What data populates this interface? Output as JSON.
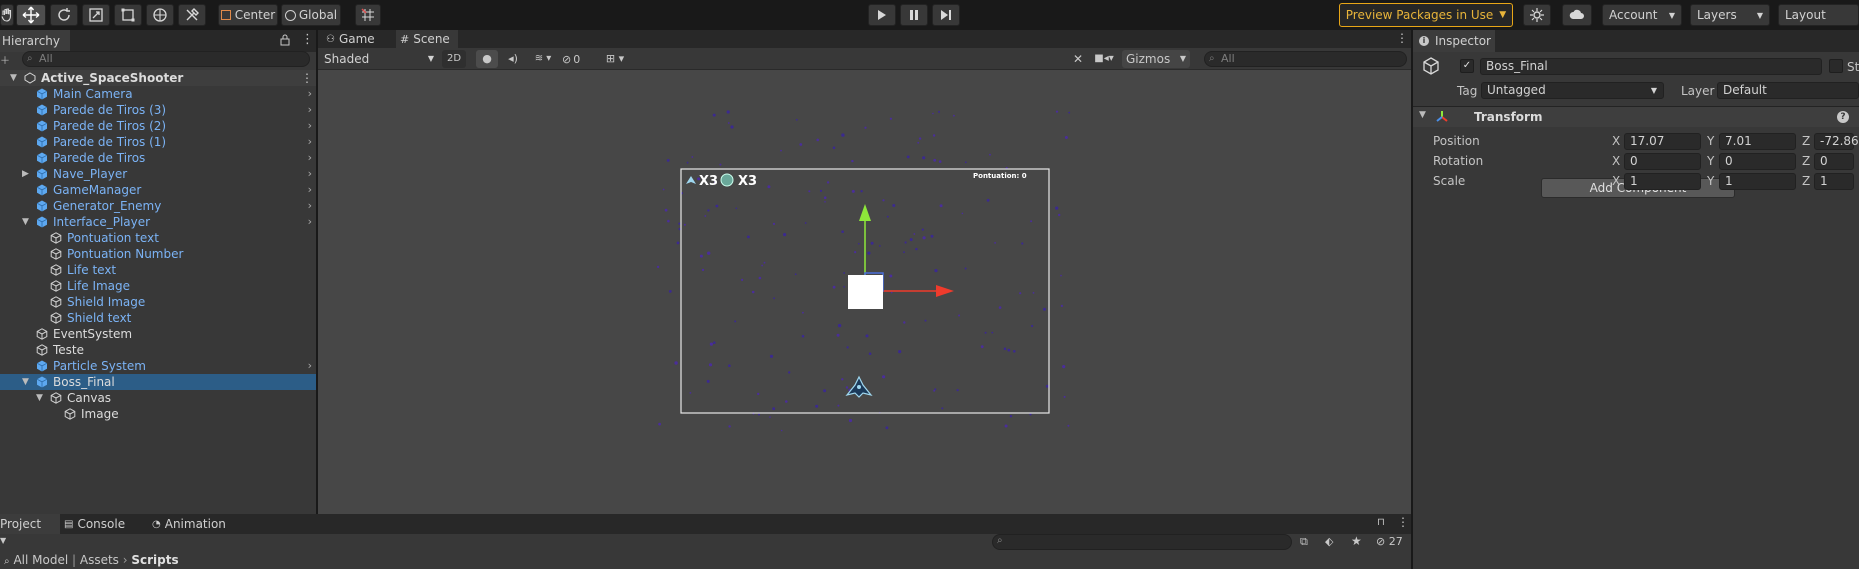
{
  "toolbar": {
    "pivot_label": "Center",
    "space_label": "Global",
    "preview_packages_label": "Preview Packages in Use",
    "account_label": "Account",
    "layers_label": "Layers",
    "layout_label": "Layout"
  },
  "hierarchy": {
    "tab_label": "Hierarchy",
    "search_placeholder": "All",
    "scene_name": "Active_SpaceShooter",
    "rows": [
      {
        "label": "Main Camera"
      },
      {
        "label": "Parede de Tiros (3)"
      },
      {
        "label": "Parede de Tiros (2)"
      },
      {
        "label": "Parede de Tiros (1)"
      },
      {
        "label": "Parede de Tiros"
      },
      {
        "label": "Nave_Player"
      },
      {
        "label": "GameManager"
      },
      {
        "label": "Generator_Enemy"
      },
      {
        "label": "Interface_Player"
      },
      {
        "label": "Pontuation text"
      },
      {
        "label": "Pontuation Number"
      },
      {
        "label": "Life text"
      },
      {
        "label": "Life Image"
      },
      {
        "label": "Shield Image"
      },
      {
        "label": "Shield text"
      },
      {
        "label": "EventSystem"
      },
      {
        "label": "Teste"
      },
      {
        "label": "Particle System"
      },
      {
        "label": "Boss_Final"
      },
      {
        "label": "Canvas"
      },
      {
        "label": "Image"
      }
    ]
  },
  "scene": {
    "tab_game": "Game",
    "tab_scene": "Scene",
    "draw_mode": "Shaded",
    "mode_2d": "2D",
    "hidden_count": "0",
    "gizmos_label": "Gizmos",
    "search_placeholder": "All",
    "hud_lives": "X3",
    "hud_shields": "X3",
    "hud_score": "Pontuation: 0"
  },
  "inspector": {
    "tab_label": "Inspector",
    "object_name": "Boss_Final",
    "static_label": "St",
    "tag_label": "Tag",
    "tag_value": "Untagged",
    "layer_label": "Layer",
    "layer_value": "Default",
    "component_title": "Transform",
    "position_label": "Position",
    "rotation_label": "Rotation",
    "scale_label": "Scale",
    "x": "X",
    "y": "Y",
    "z": "Z",
    "position": {
      "x": "17.07",
      "y": "7.01",
      "z": "-72.860"
    },
    "rotation": {
      "x": "0",
      "y": "0",
      "z": "0"
    },
    "scale": {
      "x": "1",
      "y": "1",
      "z": "1"
    },
    "add_component_label": "Add Component"
  },
  "project": {
    "tab_project": "Project",
    "tab_console": "Console",
    "tab_animation": "Animation",
    "hidden_count": "27",
    "breadcrumb": [
      "All Model",
      "Assets",
      "Scripts"
    ]
  },
  "colors": {
    "accent_selection": "#2c5d87",
    "prefab_blue": "#7bb3f5",
    "warning_orange": "#e8a617"
  }
}
